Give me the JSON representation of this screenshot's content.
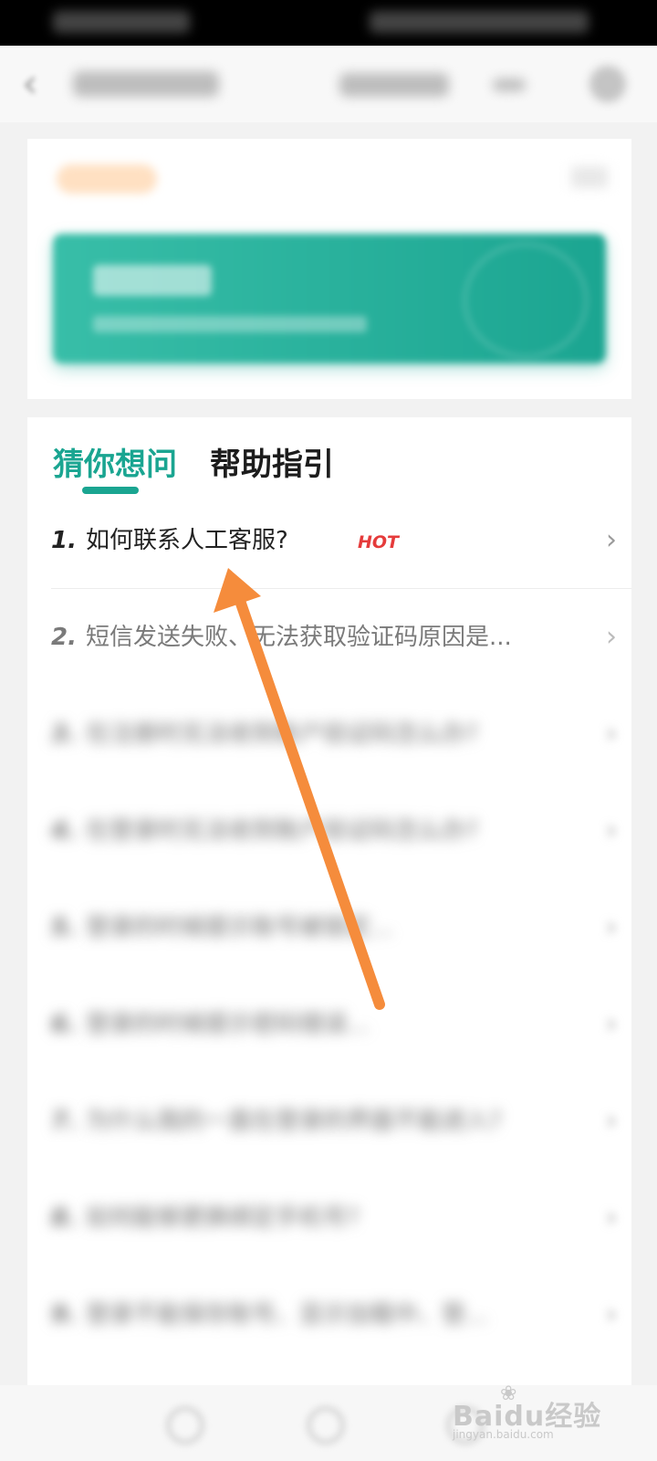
{
  "tabs": [
    {
      "label": "猜你想问",
      "active": true
    },
    {
      "label": "帮助指引",
      "active": false
    }
  ],
  "questions": [
    {
      "num": "1.",
      "text": "如何联系人工客服?",
      "badge": "HOT"
    },
    {
      "num": "2.",
      "text": "短信发送失败、无法获取验证码原因是..."
    },
    {
      "num": "3.",
      "text": "在注册时无法收到账户验证码怎么办?"
    },
    {
      "num": "4.",
      "text": "在登录时无法收到账户验证码怎么办?"
    },
    {
      "num": "5.",
      "text": "登录的时候提示账号被锁定..."
    },
    {
      "num": "6.",
      "text": "登录的时候提示密码错误..."
    },
    {
      "num": "7.",
      "text": "为什么我的一直在登录的界面不能进入?"
    },
    {
      "num": "8.",
      "text": "如何能够更换绑定手机号?"
    },
    {
      "num": "9.",
      "text": "登录不能保存账号、显示加载中、登..."
    }
  ],
  "chevron": "›",
  "watermark": {
    "main": "Baidu经验",
    "sub": "jingyan.baidu.com"
  },
  "colors": {
    "accent": "#1aa591",
    "hot": "#e53b3b",
    "arrow": "#f58c3c"
  },
  "icons": [
    "back-icon",
    "gear-icon",
    "chevron-right-icon",
    "annotation-arrow-icon",
    "paw-icon"
  ]
}
